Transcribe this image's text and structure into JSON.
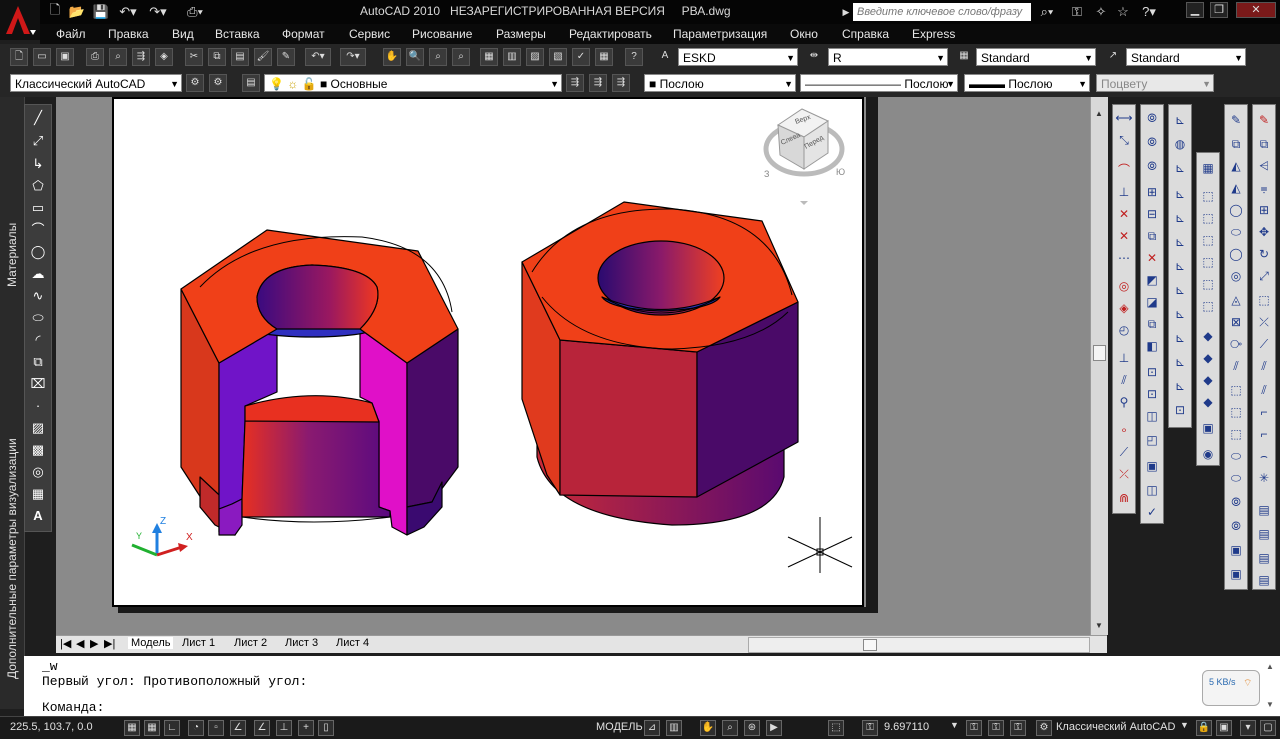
{
  "title_bar": {
    "title": "AutoCAD 2010   НЕЗАРЕГИСТРИРОВАННАЯ ВЕРСИЯ     РВА.dwg",
    "search_placeholder": "Введите ключевое слово/фразу"
  },
  "menu": {
    "items": [
      "Файл",
      "Правка",
      "Вид",
      "Вставка",
      "Формат",
      "Сервис",
      "Рисование",
      "Размеры",
      "Редактировать",
      "Параметризация",
      "Окно",
      "Справка",
      "Express"
    ]
  },
  "standard_toolbar": {
    "text_style": "ESKD",
    "dim_style": "R",
    "table_style": "Standard",
    "multileader_style": "Standard"
  },
  "workspace_toolbar": {
    "workspace": "Классический AutoCAD",
    "layer": "Основные",
    "color": "Послою",
    "linetype": "Послою",
    "lineweight": "Послою",
    "plot_style": "Поцвету"
  },
  "left_palettes": {
    "materials": "Материалы",
    "visual_styles": "Дополнительные параметры визуализации"
  },
  "viewcube": {
    "top": "Верх",
    "left": "Слева",
    "front": "Перед",
    "compass_w": "З",
    "compass_s": "Ю"
  },
  "ucs": {
    "x": "X",
    "y": "Y",
    "z": "Z"
  },
  "layout_tabs": [
    "Модель",
    "Лист 1",
    "Лист 2",
    "Лист 3",
    "Лист 4"
  ],
  "command_line": {
    "line1": "_w",
    "line2": "Первый угол: Противоположный угол:",
    "prompt": "Команда:"
  },
  "status_bar": {
    "coords": "225.5, 103.7, 0.0",
    "space": "МОДЕЛЬ",
    "scale": "9.697110",
    "workspace": "Классический AutoCAD"
  },
  "net_widget": {
    "speed": "5 KB/s"
  },
  "colors": {
    "nut_face": "#f04018",
    "nut_side_red": "#b8243a",
    "nut_side_purple": "#4a0a68",
    "nut_cut_magenta": "#e010c8",
    "nut_cut_violet": "#7a14c8"
  }
}
